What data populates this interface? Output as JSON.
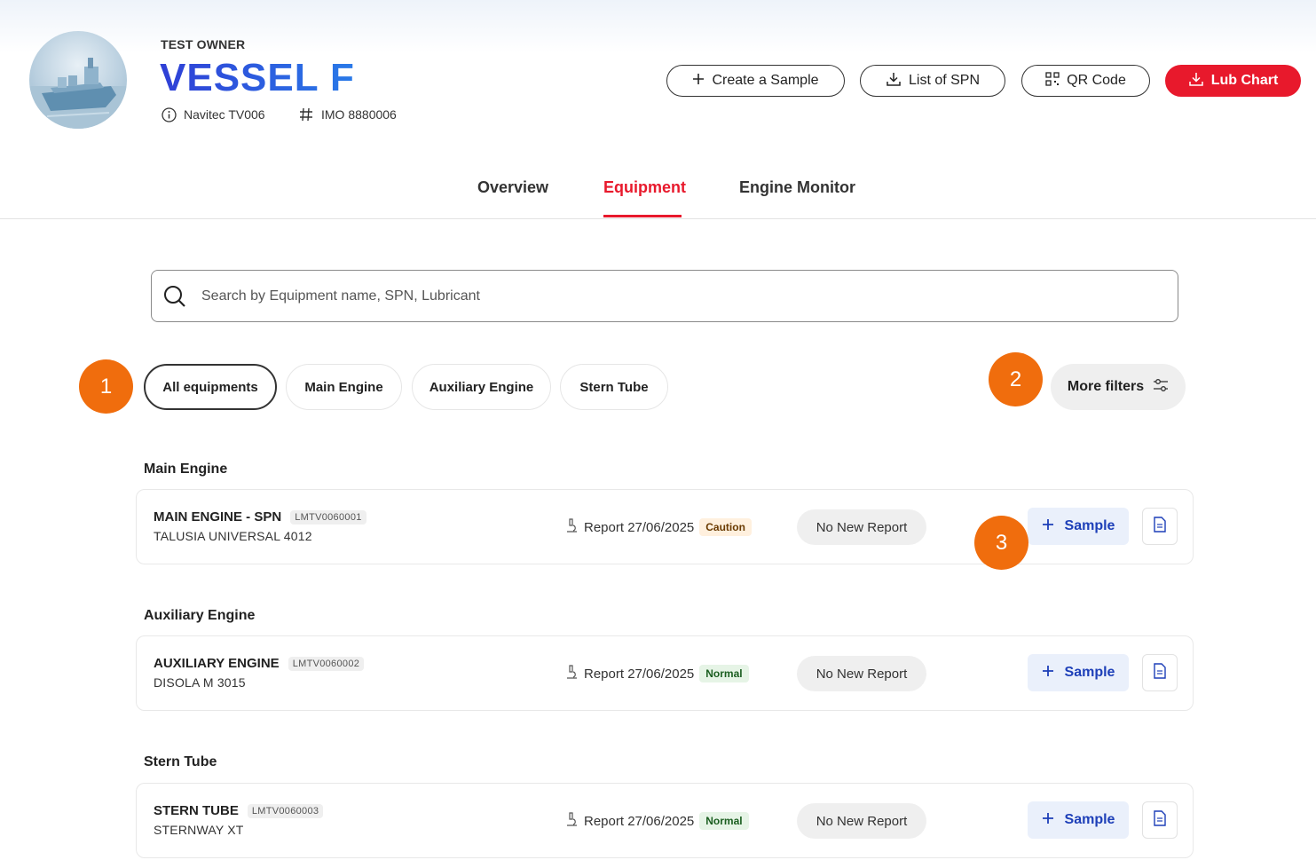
{
  "header": {
    "owner": "TEST OWNER",
    "vessel_name": "VESSEL F",
    "navitec": "Navitec TV006",
    "imo": "IMO 8880006",
    "buttons": {
      "create_sample": "Create a Sample",
      "list_spn": "List of SPN",
      "qr_code": "QR Code",
      "lub_chart": "Lub Chart"
    }
  },
  "tabs": [
    {
      "label": "Overview"
    },
    {
      "label": "Equipment",
      "active": true
    },
    {
      "label": "Engine Monitor"
    }
  ],
  "search": {
    "placeholder": "Search by Equipment name, SPN, Lubricant",
    "value": ""
  },
  "filters": {
    "chips": [
      "All equipments",
      "Main Engine",
      "Auxiliary Engine",
      "Stern Tube"
    ],
    "active": "All equipments",
    "more_filters": "More filters"
  },
  "markers": [
    "1",
    "2",
    "3"
  ],
  "sections": [
    {
      "title": "Main Engine",
      "item": {
        "name": "MAIN ENGINE - SPN",
        "spn": "LMTV0060001",
        "lubricant": "TALUSIA UNIVERSAL 4012",
        "report": "Report 27/06/2025",
        "status": "Caution",
        "new_report": "No New Report",
        "sample": "Sample"
      }
    },
    {
      "title": "Auxiliary Engine",
      "item": {
        "name": "AUXILIARY ENGINE",
        "spn": "LMTV0060002",
        "lubricant": "DISOLA M 3015",
        "report": "Report 27/06/2025",
        "status": "Normal",
        "new_report": "No New Report",
        "sample": "Sample"
      }
    },
    {
      "title": "Stern Tube",
      "item": {
        "name": "STERN TUBE",
        "spn": "LMTV0060003",
        "lubricant": "STERNWAY XT",
        "report": "Report 27/06/2025",
        "status": "Normal",
        "new_report": "No New Report",
        "sample": "Sample"
      }
    }
  ],
  "colors": {
    "accent_red": "#e8192c",
    "title_blue": "#2f3fd6",
    "sample_blue": "#1d3fb8",
    "marker_orange": "#f06d0d"
  }
}
